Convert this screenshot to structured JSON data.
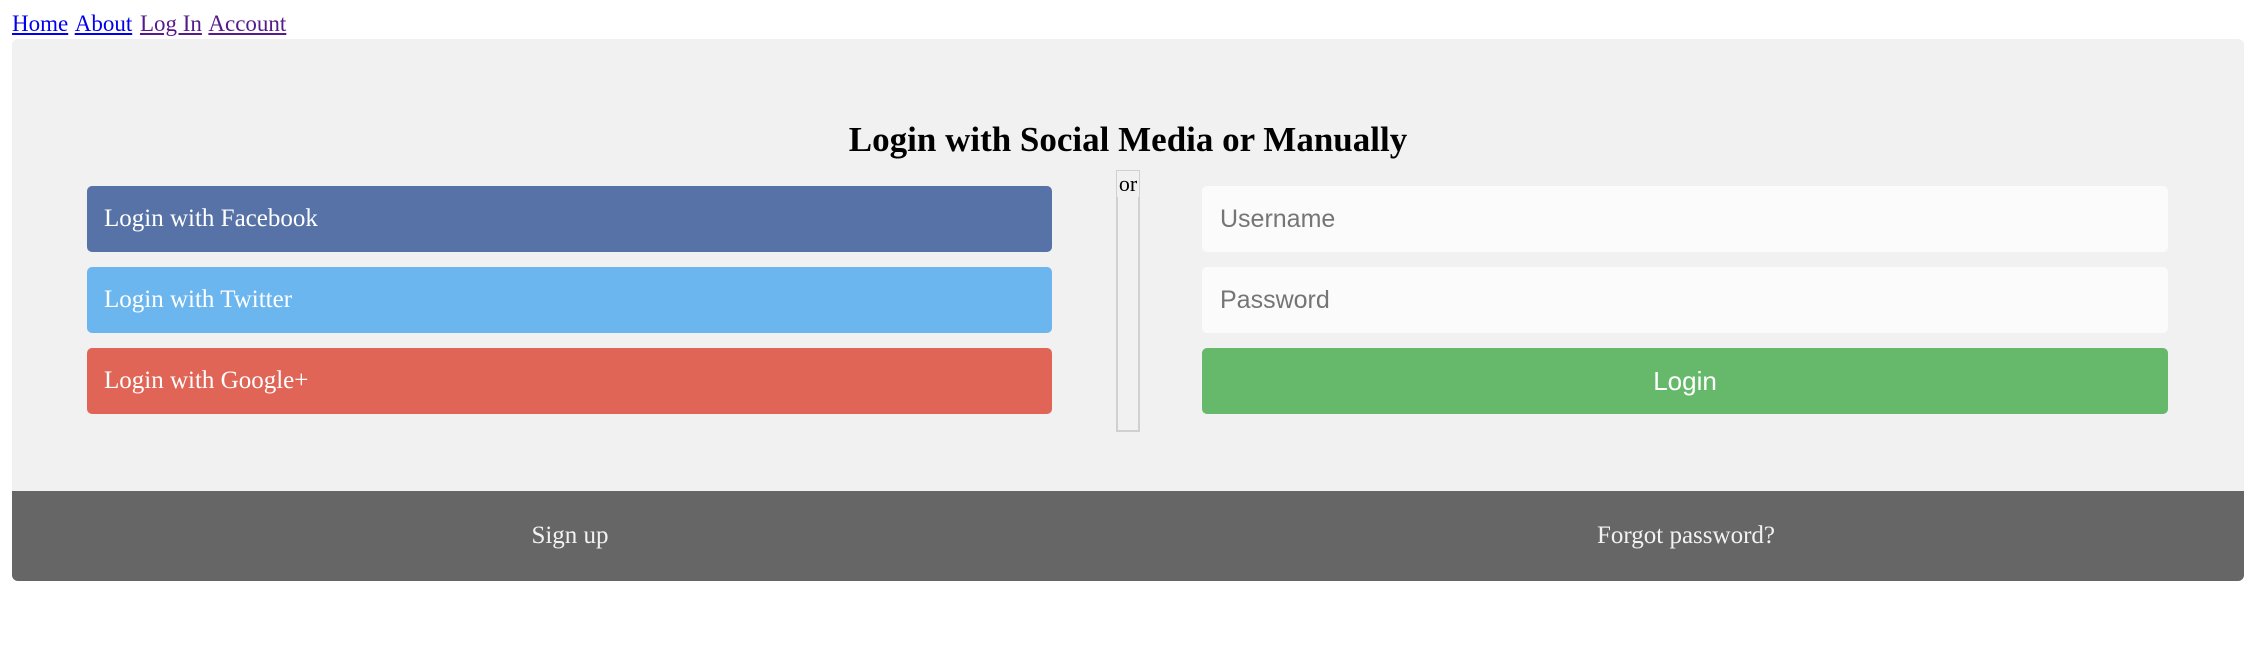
{
  "nav": {
    "links": [
      {
        "label": "Home"
      },
      {
        "label": "About"
      },
      {
        "label": "Log In"
      },
      {
        "label": "Account"
      }
    ]
  },
  "login_panel": {
    "title": "Login with Social Media or Manually",
    "social": {
      "facebook_label": "Login with Facebook",
      "twitter_label": "Login with Twitter",
      "google_label": "Login with Google+"
    },
    "divider_label": "or",
    "form": {
      "username_placeholder": "Username",
      "username_value": "",
      "password_placeholder": "Password",
      "password_value": "",
      "submit_label": "Login"
    }
  },
  "footer": {
    "signup_label": "Sign up",
    "forgot_label": "Forgot password?"
  },
  "colors": {
    "facebook": "#5672a7",
    "twitter": "#6cb6f0",
    "google": "#e06556",
    "login": "#66b96a",
    "footer": "#666666",
    "panel": "#f1f1f1"
  }
}
